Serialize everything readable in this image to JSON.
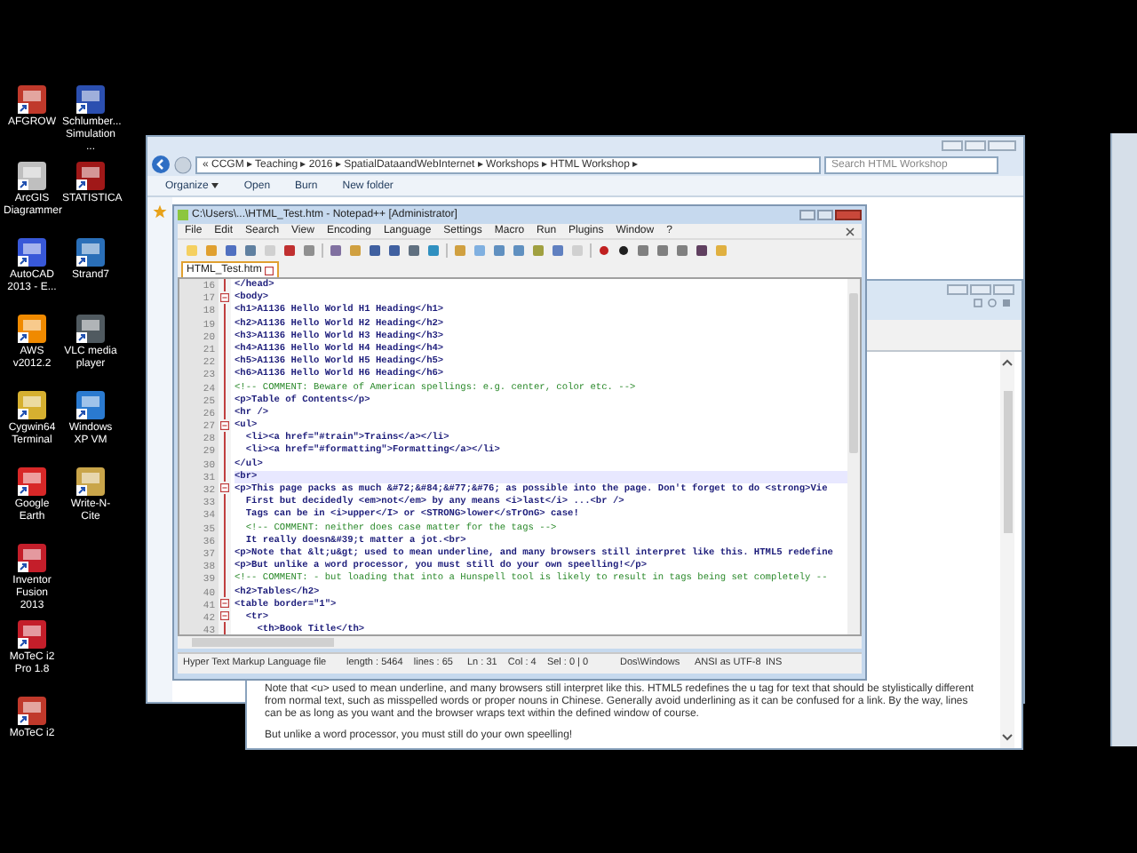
{
  "desktop_icons": [
    [
      {
        "label": "AFGROW"
      },
      {
        "label": "Schlumber... Simulation ..."
      }
    ],
    [
      {
        "label": "ArcGIS Diagrammer"
      },
      {
        "label": "STATISTICA"
      }
    ],
    [
      {
        "label": "AutoCAD 2013 - E..."
      },
      {
        "label": "Strand7"
      }
    ],
    [
      {
        "label": "AWS v2012.2"
      },
      {
        "label": "VLC media player"
      }
    ],
    [
      {
        "label": "Cygwin64 Terminal"
      },
      {
        "label": "Windows XP VM"
      }
    ],
    [
      {
        "label": "Google Earth"
      },
      {
        "label": "Write-N-Cite"
      }
    ],
    [
      {
        "label": "Inventor Fusion 2013"
      }
    ],
    [
      {
        "label": "MoTeC i2 Pro 1.8"
      }
    ],
    [
      {
        "label": "MoTeC i2"
      }
    ]
  ],
  "explorer": {
    "breadcrumb": "« CCGM ▸ Teaching ▸ 2016 ▸ SpatialDataandWebInternet ▸ Workshops ▸ HTML Workshop ▸",
    "search": {
      "placeholder": "Search HTML Workshop"
    },
    "toolbar": [
      {
        "label": "Organize",
        "menu": true
      },
      {
        "label": "Open",
        "menu": false
      },
      {
        "label": "Burn",
        "menu": false
      },
      {
        "label": "New folder",
        "menu": false
      }
    ]
  },
  "browser": {
    "paragraphs": [
      "Note that <u> used to mean underline, and many browsers still interpret like this. HTML5 redefines the u tag for text that should be stylistically different from normal text, such as misspelled words or proper nouns in Chinese. Generally avoid underlining as it can be confused for a link. By the way, lines can be as long as you want and the browser wraps text within the defined window of course.",
      "But unlike a word processor, you must still do your own speelling!"
    ]
  },
  "notepad": {
    "title": "C:\\Users\\...\\HTML_Test.htm - Notepad++ [Administrator]",
    "menu": [
      "File",
      "Edit",
      "Search",
      "View",
      "Encoding",
      "Language",
      "Settings",
      "Macro",
      "Run",
      "Plugins",
      "Window",
      "?"
    ],
    "tab": {
      "label": "HTML_Test.htm",
      "selected": true
    },
    "lines": [
      {
        "number": "16",
        "text": "</head>",
        "kind": "code",
        "fold": false,
        "current": false
      },
      {
        "number": "17",
        "text": "<body>",
        "kind": "code",
        "fold": true,
        "current": false
      },
      {
        "number": "18",
        "text": "<h1>A1136 Hello World H1 Heading</h1>",
        "kind": "code",
        "fold": false,
        "current": false
      },
      {
        "number": "19",
        "text": "<h2>A1136 Hello World H2 Heading</h2>",
        "kind": "code",
        "fold": false,
        "current": false
      },
      {
        "number": "20",
        "text": "<h3>A1136 Hello World H3 Heading</h3>",
        "kind": "code",
        "fold": false,
        "current": false
      },
      {
        "number": "21",
        "text": "<h4>A1136 Hello World H4 Heading</h4>",
        "kind": "code",
        "fold": false,
        "current": false
      },
      {
        "number": "22",
        "text": "<h5>A1136 Hello World H5 Heading</h5>",
        "kind": "code",
        "fold": false,
        "current": false
      },
      {
        "number": "23",
        "text": "<h6>A1136 Hello World H6 Heading</h6>",
        "kind": "code",
        "fold": false,
        "current": false
      },
      {
        "number": "24",
        "text": "<!-- COMMENT: Beware of American spellings: e.g. center, color etc. -->",
        "kind": "comment",
        "fold": false,
        "current": false
      },
      {
        "number": "25",
        "text": "<p>Table of Contents</p>",
        "kind": "code",
        "fold": false,
        "current": false
      },
      {
        "number": "26",
        "text": "<hr />",
        "kind": "code",
        "fold": false,
        "current": false
      },
      {
        "number": "27",
        "text": "<ul>",
        "kind": "code",
        "fold": true,
        "current": false
      },
      {
        "number": "28",
        "text": "  <li><a href=\"#train\">Trains</a></li>",
        "kind": "code",
        "fold": false,
        "current": false
      },
      {
        "number": "29",
        "text": "  <li><a href=\"#formatting\">Formatting</a></li>",
        "kind": "code",
        "fold": false,
        "current": false
      },
      {
        "number": "30",
        "text": "</ul>",
        "kind": "code",
        "fold": false,
        "current": false
      },
      {
        "number": "31",
        "text": "<br>",
        "kind": "code",
        "fold": false,
        "current": true
      },
      {
        "number": "32",
        "text": "<p>This page packs as much &#72;&#84;&#77;&#76; as possible into the page. Don't forget to do <strong>Vie",
        "kind": "code",
        "fold": true,
        "current": false
      },
      {
        "number": "33",
        "text": "  First but decidedly <em>not</em> by any means <i>last</i> ...<br />",
        "kind": "code",
        "fold": false,
        "current": false
      },
      {
        "number": "34",
        "text": "  Tags can be in <i>upper</I> or <STRONG>lower</sTrOnG> case!",
        "kind": "code",
        "fold": false,
        "current": false
      },
      {
        "number": "35",
        "text": "  <!-- COMMENT: neither does case matter for the tags -->",
        "kind": "comment",
        "fold": false,
        "current": false
      },
      {
        "number": "36",
        "text": "  It really doesn&#39;t matter a jot.<br>",
        "kind": "code",
        "fold": false,
        "current": false
      },
      {
        "number": "37",
        "text": "<p>Note that &lt;u&gt; used to mean underline, and many browsers still interpret like this. HTML5 redefine",
        "kind": "code",
        "fold": false,
        "current": false
      },
      {
        "number": "38",
        "text": "<p>But unlike a word processor, you must still do your own speelling!</p>",
        "kind": "code",
        "fold": false,
        "current": false
      },
      {
        "number": "39",
        "text": "<!-- COMMENT: - but loading that into a Hunspell tool is likely to result in tags being set completely --",
        "kind": "comment",
        "fold": false,
        "current": false
      },
      {
        "number": "40",
        "text": "<h2>Tables</h2>",
        "kind": "code",
        "fold": false,
        "current": false
      },
      {
        "number": "41",
        "text": "<table border=\"1\">",
        "kind": "code",
        "fold": true,
        "current": false
      },
      {
        "number": "42",
        "text": "  <tr>",
        "kind": "code",
        "fold": true,
        "current": false
      },
      {
        "number": "43",
        "text": "    <th>Book Title</th>",
        "kind": "code",
        "fold": false,
        "current": false
      }
    ],
    "status_bar": [
      "Hyper Text Markup Language file",
      "length : 5464    lines : 65",
      "Ln : 31    Col : 4    Sel : 0 | 0",
      "Dos\\Windows",
      "ANSI as UTF-8",
      "INS"
    ]
  }
}
